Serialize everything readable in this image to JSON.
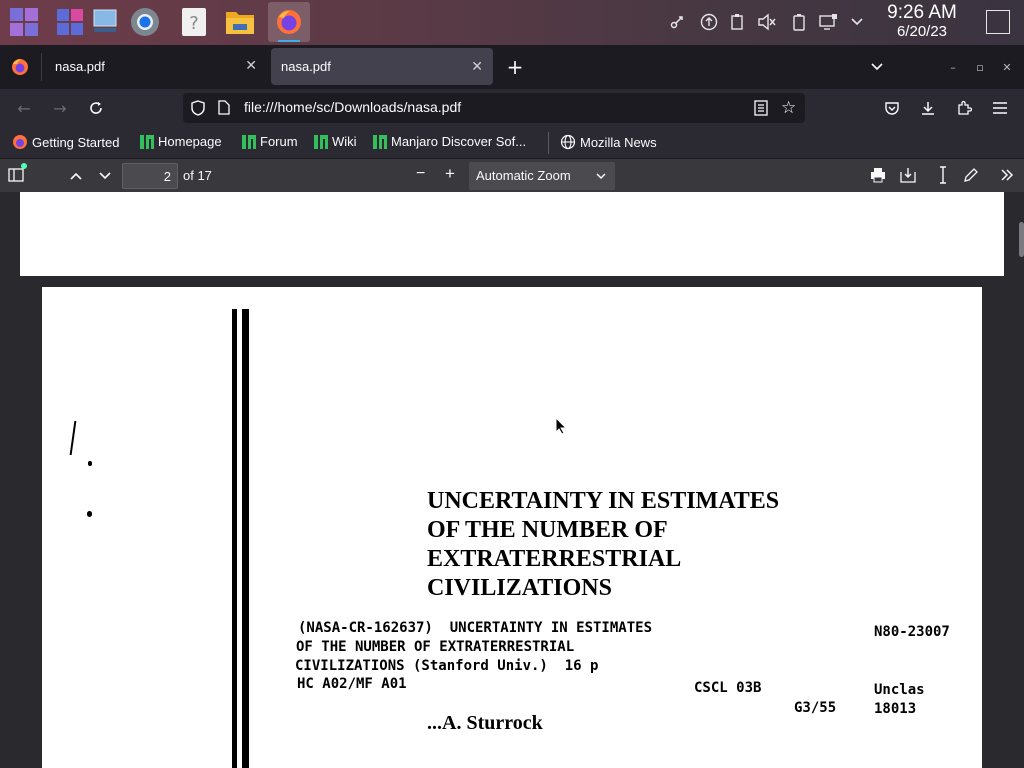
{
  "taskbar": {
    "apps": [
      "app-launcher",
      "window-switcher",
      "desktop",
      "chromium",
      "help",
      "file-manager",
      "firefox"
    ],
    "clock_time": "9:26 AM",
    "clock_date": "6/20/23"
  },
  "tabs": [
    {
      "label": "nasa.pdf",
      "active": false
    },
    {
      "label": "nasa.pdf",
      "active": true
    }
  ],
  "nav": {
    "url": "file:///home/sc/Downloads/nasa.pdf"
  },
  "bookmarks": [
    {
      "label": "Getting Started",
      "icon": "firefox-icon"
    },
    {
      "label": "Homepage",
      "icon": "manjaro-icon"
    },
    {
      "label": "Forum",
      "icon": "manjaro-icon"
    },
    {
      "label": "Wiki",
      "icon": "manjaro-icon"
    },
    {
      "label": "Manjaro Discover Sof...",
      "icon": "manjaro-icon"
    },
    {
      "label": "Mozilla News",
      "icon": "globe-icon"
    }
  ],
  "pdf_toolbar": {
    "page_number": "2",
    "page_count": "of 17",
    "zoom": "Automatic Zoom"
  },
  "document": {
    "title_lines": [
      "UNCERTAINTY IN ESTIMATES",
      "OF THE NUMBER OF",
      "EXTRATERRESTRIAL",
      "CIVILIZATIONS"
    ],
    "catalog_lines": [
      "(NASA-CR-162637)  UNCERTAINTY IN ESTIMATES",
      "OF THE NUMBER OF EXTRATERRESTRIAL",
      "CIVILIZATIONS (Stanford Univ.)  16 p",
      "HC A02/MF A01"
    ],
    "accession": "N80-23007",
    "cscl": "CSCL 03B",
    "unclas": "Unclas",
    "group": "G3/55",
    "number": "18013",
    "author": "...A. Sturrock"
  }
}
